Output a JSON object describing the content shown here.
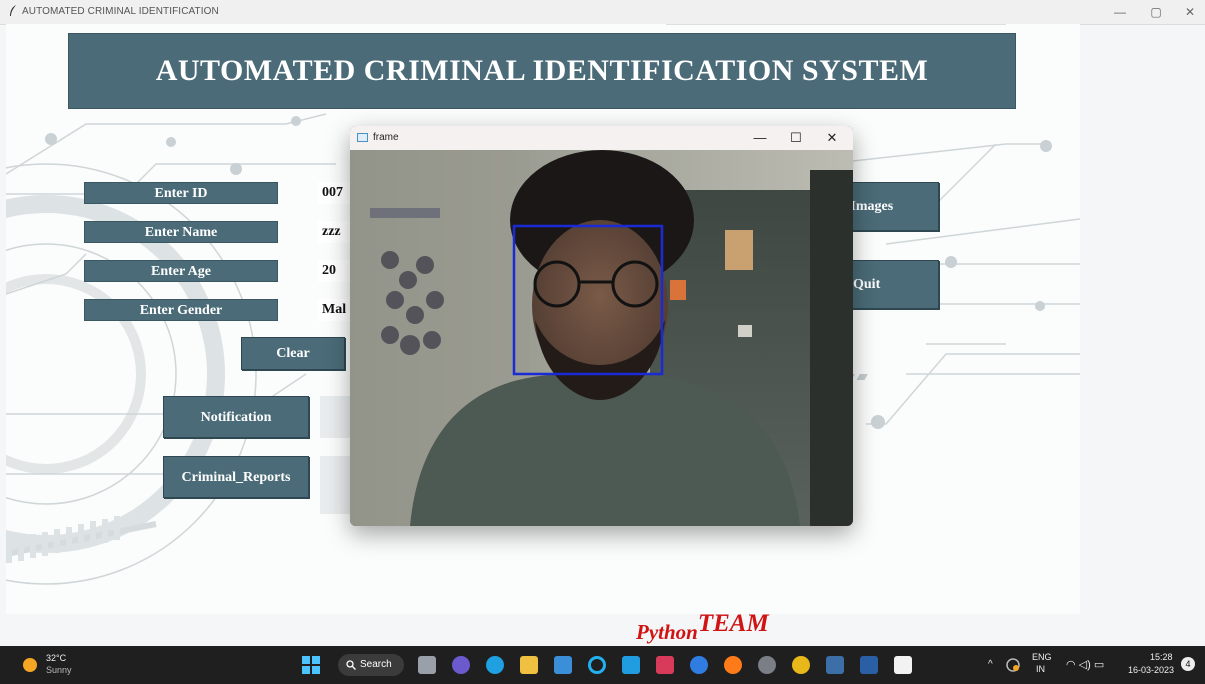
{
  "app": {
    "window_title": "AUTOMATED CRIMINAL IDENTIFICATION",
    "window_controls": [
      "—",
      "▢",
      "✕"
    ],
    "banner": "AUTOMATED CRIMINAL IDENTIFICATION SYSTEM"
  },
  "form": {
    "id_label": "Enter ID",
    "id_value": "007",
    "name_label": "Enter Name",
    "name_value": "zzz",
    "age_label": "Enter Age",
    "age_value": "20",
    "gender_label": "Enter Gender",
    "gender_value": "Mal"
  },
  "buttons": {
    "clear": "Clear",
    "notification": "Notification",
    "criminal_reports": "Criminal_Reports",
    "train_images": "ı Images",
    "quit": "Quit"
  },
  "frame_window": {
    "title": "frame",
    "controls": [
      "—",
      "☐",
      "✕"
    ]
  },
  "watermark": {
    "part1": "Python",
    "part2": "TEAM"
  },
  "taskbar": {
    "weather_temp": "32°C",
    "weather_text": "Sunny",
    "search_label": "Search",
    "lang_top": "ENG",
    "lang_bottom": "IN",
    "time": "15:28",
    "date": "16-03-2023",
    "notification_count": "4",
    "tray_chevron": "^"
  },
  "colors": {
    "accent": "#4a6b77",
    "watermark": "#d01414",
    "face_box": "#1a2ad4",
    "taskbar": "#1f1f1f"
  }
}
